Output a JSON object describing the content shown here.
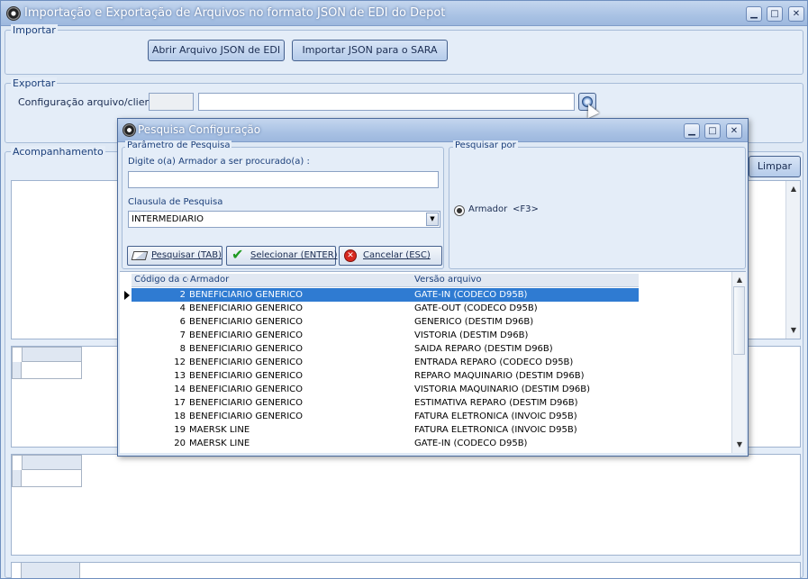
{
  "window": {
    "title": "Importação e Exportação de Arquivos no formato JSON de EDI do Depot"
  },
  "importar": {
    "label": "Importar",
    "btn_abrir": "Abrir Arquivo JSON de EDI",
    "btn_importar": "Importar JSON para o SARA"
  },
  "exportar": {
    "label": "Exportar",
    "config_label": "Configuração arquivo/cliente:",
    "code_value": "",
    "name_value": ""
  },
  "acompanhamento": {
    "label": "Acompanhamento",
    "btn_limpar": "Limpar"
  },
  "dialog": {
    "title": "Pesquisa Configuração",
    "param_label": "Parâmetro de Pesquisa",
    "search_prompt": "Digite o(a) Armador a ser procurado(a) :",
    "search_value": "",
    "clause_label": "Clausula de Pesquisa",
    "clause_value": "INTERMEDIARIO",
    "pesquisar_por_label": "Pesquisar por",
    "radio_label": "Armador",
    "radio_hotkey": "<F3>",
    "btn_pesquisar": "Pesquisar (TAB)",
    "btn_selecionar": "Selecionar (ENTER)",
    "btn_cancelar": "Cancelar (ESC)",
    "grid": {
      "columns": [
        "Código da co",
        "Armador",
        "Versão arquivo"
      ],
      "rows": [
        {
          "codigo": "2",
          "armador": "BENEFICIARIO GENERICO",
          "versao": "GATE-IN (CODECO D95B)",
          "selected": true
        },
        {
          "codigo": "4",
          "armador": "BENEFICIARIO GENERICO",
          "versao": "GATE-OUT (CODECO D95B)"
        },
        {
          "codigo": "6",
          "armador": "BENEFICIARIO GENERICO",
          "versao": "GENERICO (DESTIM D96B)"
        },
        {
          "codigo": "7",
          "armador": "BENEFICIARIO GENERICO",
          "versao": "VISTORIA (DESTIM D96B)"
        },
        {
          "codigo": "8",
          "armador": "BENEFICIARIO GENERICO",
          "versao": "SAIDA REPARO (DESTIM D96B)"
        },
        {
          "codigo": "12",
          "armador": "BENEFICIARIO GENERICO",
          "versao": "ENTRADA REPARO (CODECO D95B)"
        },
        {
          "codigo": "13",
          "armador": "BENEFICIARIO GENERICO",
          "versao": "REPARO MAQUINARIO (DESTIM D96B)"
        },
        {
          "codigo": "14",
          "armador": "BENEFICIARIO GENERICO",
          "versao": "VISTORIA MAQUINARIO (DESTIM D96B)"
        },
        {
          "codigo": "17",
          "armador": "BENEFICIARIO GENERICO",
          "versao": "ESTIMATIVA REPARO (DESTIM D96B)"
        },
        {
          "codigo": "18",
          "armador": "BENEFICIARIO GENERICO",
          "versao": "FATURA ELETRONICA (INVOIC D95B)"
        },
        {
          "codigo": "19",
          "armador": "MAERSK LINE",
          "versao": "FATURA ELETRONICA (INVOIC D95B)"
        },
        {
          "codigo": "20",
          "armador": "MAERSK LINE",
          "versao": "GATE-IN (CODECO D95B)"
        }
      ]
    }
  }
}
